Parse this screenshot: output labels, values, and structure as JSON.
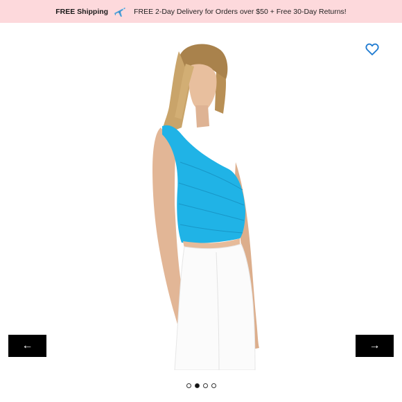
{
  "promo": {
    "strong": "FREE Shipping",
    "text": "FREE 2-Day Delivery for Orders over $50 + Free 30-Day Returns!",
    "plane_icon": "airplane-icon"
  },
  "wishlist": {
    "icon": "heart-outline-icon",
    "color": "#1f7bd1"
  },
  "product_image": {
    "subject": "model wearing one-shoulder top",
    "top_color": "#20b3e6",
    "pants_color": "#ffffff"
  },
  "carousel": {
    "prev_icon": "←",
    "next_icon": "→",
    "slide_count": 4,
    "active_index": 1
  }
}
